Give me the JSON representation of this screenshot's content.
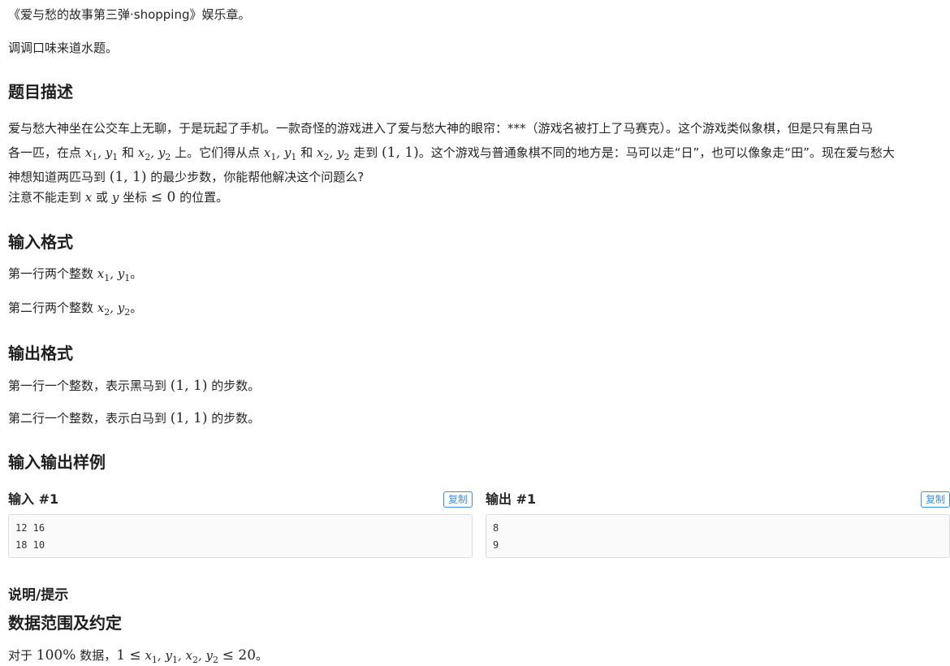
{
  "intro": {
    "line1": "《爱与愁的故事第三弹·shopping》娱乐章。",
    "line2": "调调口味来道水题。"
  },
  "description": {
    "heading": "题目描述",
    "p1_a": "爱与愁大神坐在公交车上无聊，于是玩起了手机。一款奇怪的游戏进入了爱与愁大神的眼帘：***（游戏名被打上了马赛克）。这个游戏类似象棋，但是只有黑白马",
    "p1_b": "各一匹，在点",
    "p1_c": "和",
    "p1_d": "上。它们得从点",
    "p1_e": "和",
    "p1_f": "走到",
    "p1_g": "。这个游戏与普通象棋不同的地方是：马可以走“日”，也可以像象走“田”。现在爱与愁大",
    "p1_h": "神想知道两匹马到",
    "p1_i": "的最少步数，你能帮他解决这个问题么?",
    "p2_a": "注意不能走到",
    "p2_b": "或",
    "p2_c": "坐标",
    "p2_d": "的位置。"
  },
  "input_format": {
    "heading": "输入格式",
    "line1": "第一行两个整数",
    "line2": "第二行两个整数"
  },
  "output_format": {
    "heading": "输出格式",
    "line1_a": "第一行一个整数，表示黑马到",
    "line1_b": "的步数。",
    "line2_a": "第二行一个整数，表示白马到",
    "line2_b": "的步数。"
  },
  "samples": {
    "heading": "输入输出样例",
    "input_title": "输入 #1",
    "output_title": "输出 #1",
    "copy_label": "复制",
    "input_text": "12 16\n18 10",
    "output_text": "8\n9"
  },
  "hint": {
    "heading": "说明/提示",
    "subheading": "数据范围及约定",
    "text_a": "对于",
    "text_pct": "100%",
    "text_b": "数据，",
    "text_c": "。"
  },
  "math": {
    "point": "(1, 1)",
    "leq_zero": "≤ 0",
    "range_lo": "1 ≤",
    "range_hi": "≤ 20"
  }
}
